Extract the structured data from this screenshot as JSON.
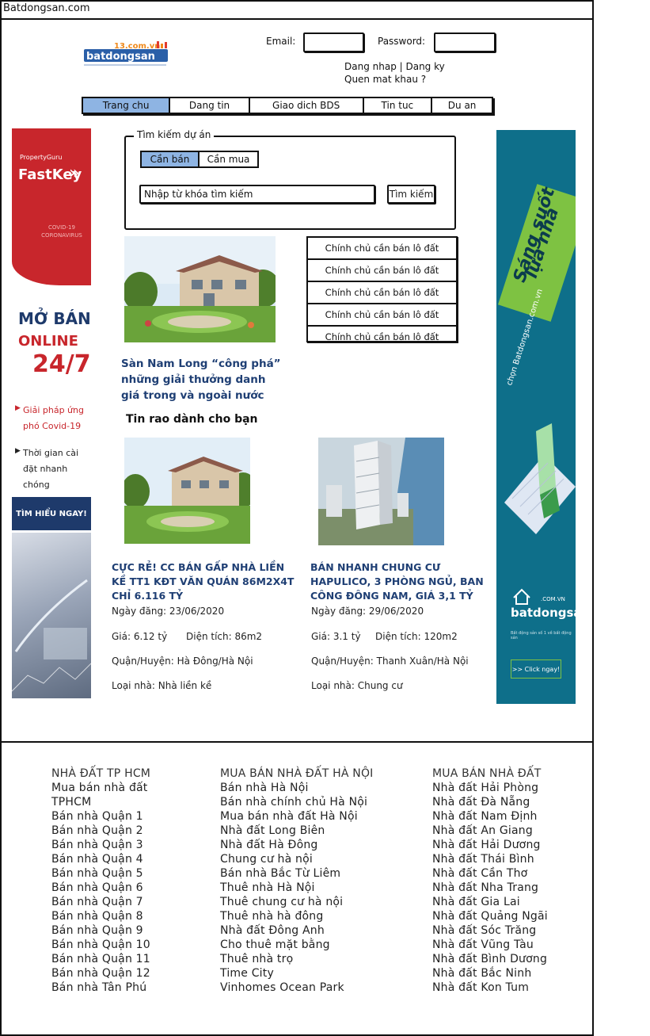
{
  "window": {
    "title": "Batdongsan.com"
  },
  "header": {
    "logo_text": "batdongsan",
    "logo_sub": "13.com.vn",
    "email_label": "Email:",
    "password_label": "Password:",
    "login_register": "Dang nhap | Dang ky",
    "forgot_password": "Quen mat khau ?"
  },
  "nav": {
    "items": [
      {
        "label": "Trang chu",
        "active": true
      },
      {
        "label": "Dang tin"
      },
      {
        "label": "Giao dich BDS"
      },
      {
        "label": "Tin tuc"
      },
      {
        "label": "Du an"
      }
    ]
  },
  "left_ad": {
    "brand": "PropertyGuru",
    "product": "FastKey",
    "tag": "COVID-19 CORONAVIRUS",
    "headline1": "MỞ BÁN",
    "headline2": "ONLINE",
    "headline3": "24/7",
    "bullet1": "Giải pháp ứng phó Covid-19",
    "bullet2": "Thời gian cài đặt nhanh chóng",
    "cta": "TÌM HIỂU NGAY!"
  },
  "right_ad": {
    "slogan1": "Sáng suốt",
    "slogan2": "lựa nhà",
    "sub": "chọn Batdongsan.com.vn",
    "brand": "batdongsan",
    "brand_suffix": ".COM.VN",
    "brand_tag": "Bất động sản số 1 về bất động sản",
    "cta": ">> Click ngay!"
  },
  "search": {
    "legend": "Tìm kiếm dự án",
    "tab_sell": "Cần bán",
    "tab_buy": "Cần mua",
    "placeholder": "Nhập từ khóa tìm kiếm",
    "button": "Tìm kiếm"
  },
  "featured": {
    "title": "Sàn Nam Long “công phá” những giải thưởng danh giá trong và ngoài nước"
  },
  "listings_box": {
    "items": [
      "Chính chủ cần bán lô đất",
      "Chính chủ cần bán lô đất",
      "Chính chủ cần bán lô đất",
      "Chính chủ cần bán lô đất",
      "Chính chủ cần bán lô đất"
    ]
  },
  "for_you": {
    "title": "Tin rao dành cho bạn",
    "cards": [
      {
        "title": "Cực rẻ! CC bán gấp nhà liền kề TT1 KĐT Văn Quán 86m2x4T chỉ 6.116 tỷ",
        "date": "Ngày đăng: 23/06/2020",
        "price": "Giá: 6.12 tỷ",
        "area": "Diện tích: 86m2",
        "district": "Quận/Huyện: Hà Đông/Hà Nội",
        "type": "Loại nhà: Nhà liền kề"
      },
      {
        "title": "BÁN NHANH CHUNG CƯ HAPULICO, 3 PHÒNG NGỦ, BAN CÔNG ĐÔNG NAM, GIÁ 3,1 TỶ",
        "date": "Ngày đăng: 29/06/2020",
        "price": "Giá: 3.1 tỷ",
        "area": "Diện tích: 120m2",
        "district": "Quận/Huyện: Thanh Xuân/Hà Nội",
        "type": "Loại nhà: Chung cư"
      }
    ]
  },
  "footer": {
    "col1": [
      "NHÀ ĐẤT TP HCM",
      "Mua bán nhà đất",
      "TPHCM",
      "Bán nhà Quận 1",
      "Bán nhà Quận 2",
      "Bán nhà Quận 3",
      "Bán nhà Quận 4",
      "Bán nhà Quận 5",
      "Bán nhà Quận 6",
      "Bán nhà Quận 7",
      "Bán nhà Quận 8",
      "Bán nhà Quận 9",
      "Bán nhà Quận 10",
      "Bán nhà Quận 11",
      "Bán nhà Quận 12",
      "Bán nhà Tân Phú"
    ],
    "col2": [
      "MUA BÁN NHÀ ĐẤT HÀ NỘI",
      "Bán nhà Hà Nội",
      "Bán nhà chính chủ Hà Nội",
      "Mua bán nhà đất Hà Nội",
      "Nhà đất Long Biên",
      "Nhà đất Hà Đông",
      "Chung cư hà nội",
      "Bán nhà Bắc Từ Liêm",
      "Thuê nhà Hà Nội",
      "Thuê chung cư hà nội",
      "Thuê nhà hà đông",
      "Nhà đất Đông Anh",
      "Cho thuê mặt bằng",
      "Thuê nhà trọ",
      "Time City",
      "Vinhomes Ocean Park"
    ],
    "col3": [
      "MUA BÁN NHÀ ĐẤT",
      "Nhà đất Hải Phòng",
      "Nhà đất Đà Nẵng",
      "Nhà đất Nam Định",
      "Nhà đất An Giang",
      "Nhà đất Hải Dương",
      "Nhà đất Thái Bình",
      "Nhà đất Cần Thơ",
      "Nhà đất Nha Trang",
      "Nhà đất Gia Lai",
      "Nhà đất Quảng Ngãi",
      "Nhà đất Sóc Trăng",
      "Nhà đất Vũng Tàu",
      "Nhà đất Bình Dương",
      "Nhà đất Bắc Ninh",
      "Nhà đất Kon Tum"
    ]
  }
}
